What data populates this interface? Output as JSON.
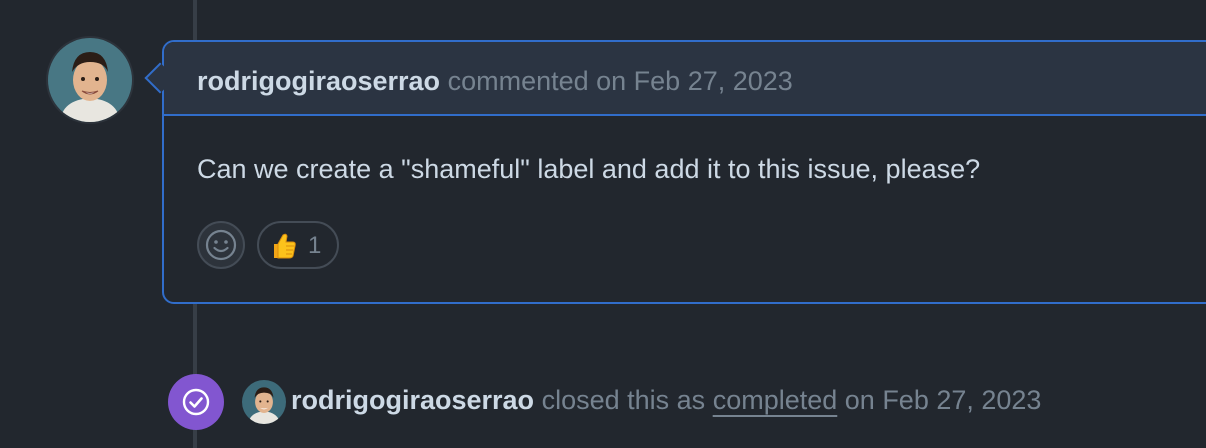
{
  "comment": {
    "author": "rodrigogiraoserrao",
    "action": "commented on Feb 27, 2023",
    "body": "Can we create a \"shameful\" label and add it to this issue, please?",
    "reactions": [
      {
        "emoji_icon": "thumbs-up-icon",
        "count": "1"
      }
    ]
  },
  "event": {
    "actor": "rodrigogiraoserrao",
    "prefix": "closed this as",
    "link_text": "completed",
    "suffix": "on Feb 27, 2023"
  },
  "colors": {
    "background": "#22272e",
    "accent_border": "#316dca",
    "closed_badge": "#8256d0"
  }
}
